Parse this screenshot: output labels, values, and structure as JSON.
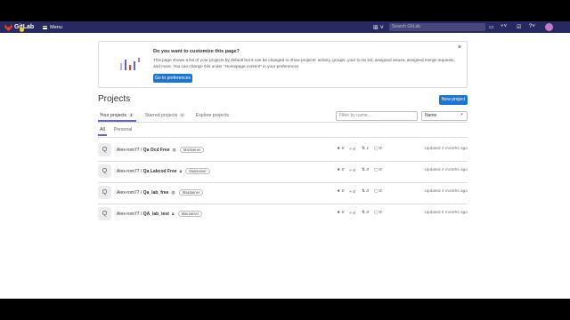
{
  "header": {
    "brand": "GitLab",
    "menu_label": "Menu",
    "search_placeholder": "Search GitLab"
  },
  "banner": {
    "title": "Do you want to customize this page?",
    "text": "This page shows a list of your projects by default but it can be changed to show projects' activity, groups, your to-do list, assigned issues, assigned merge requests, and more. You can change this under \"Homepage content\" in your preferences",
    "button": "Go to preferences",
    "close": "×"
  },
  "page": {
    "title": "Projects",
    "new_project": "New project",
    "tabs": [
      {
        "label": "Your projects",
        "count": "4"
      },
      {
        "label": "Starred projects",
        "count": "0"
      },
      {
        "label": "Explore projects",
        "count": ""
      }
    ],
    "filter_placeholder": "Filter by name...",
    "sort_label": "Name",
    "subtabs": [
      "All",
      "Personal"
    ]
  },
  "projects": [
    {
      "avatar": "Q",
      "namespace": "Alex-rom77 / ",
      "name": "Qa Ocd Free",
      "visibility_icon": "globe-icon",
      "role": "Maintainer",
      "stars": "0",
      "forks": "0",
      "mrs": "1",
      "issues": "0",
      "updated": "Updated 4 months ago"
    },
    {
      "avatar": "Q",
      "namespace": "Alex-rom77 / ",
      "name": "Qa Labcod Free",
      "visibility_icon": "lock-icon",
      "role": "Maintainer",
      "stars": "0",
      "forks": "0",
      "mrs": "0",
      "issues": "0",
      "updated": "Updated 4 months ago"
    },
    {
      "avatar": "Q",
      "namespace": "Alex-rom77 / ",
      "name": "Qa_lab_free",
      "visibility_icon": "globe-icon",
      "role": "Maintainer",
      "stars": "0",
      "forks": "0",
      "mrs": "0",
      "issues": "0",
      "updated": "Updated 4 months ago"
    },
    {
      "avatar": "Q",
      "namespace": "Alex-rom77 / ",
      "name": "QA_lab_test",
      "visibility_icon": "lock-icon",
      "role": "Maintainer",
      "stars": "0",
      "forks": "0",
      "mrs": "0",
      "issues": "0",
      "updated": "Updated 6 months ago"
    }
  ],
  "colors": {
    "topbar": "#292961",
    "primary": "#1f75cb",
    "tab_active": "#6666c4"
  }
}
